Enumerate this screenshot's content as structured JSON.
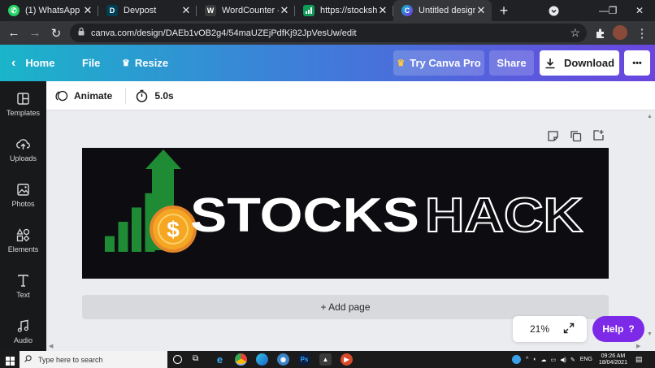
{
  "browser": {
    "tabs": [
      {
        "title": "(1) WhatsApp",
        "icon": "whatsapp-icon",
        "color": "#25d366"
      },
      {
        "title": "Devpost",
        "icon": "devpost-icon",
        "color": "#003e54"
      },
      {
        "title": "WordCounter - C",
        "icon": "wordcounter-icon",
        "color": "#3a3a3a"
      },
      {
        "title": "https://stocksha",
        "icon": "stocks-chart-icon",
        "color": "#0f9d58"
      },
      {
        "title": "Untitled design",
        "icon": "canva-icon",
        "color": "#00c4cc"
      }
    ],
    "new_tab_label": "+",
    "url": "canva.com/design/DAEb1vOB2g4/54maUZEjPdfKj92JpVesUw/edit"
  },
  "canva_header": {
    "home_label": "Home",
    "file_label": "File",
    "resize_label": "Resize",
    "try_pro_label": "Try Canva Pro",
    "share_label": "Share",
    "download_label": "Download",
    "more_label": "•••"
  },
  "sidebar": {
    "items": [
      {
        "label": "Templates",
        "icon": "templates-icon"
      },
      {
        "label": "Uploads",
        "icon": "upload-icon"
      },
      {
        "label": "Photos",
        "icon": "photos-icon"
      },
      {
        "label": "Elements",
        "icon": "elements-icon"
      },
      {
        "label": "Text",
        "icon": "text-icon"
      },
      {
        "label": "Audio",
        "icon": "audio-icon"
      }
    ]
  },
  "editor_toolbar": {
    "animate_label": "Animate",
    "duration": "5.0s"
  },
  "design": {
    "word_solid": "STOCKS",
    "word_outline": "HACK",
    "coin_symbol": "$",
    "bar_levels": [
      0.22,
      0.42,
      0.62,
      0.82,
      1.0
    ],
    "background": "#0d0d11",
    "bar_color": "#1f8b34",
    "coin_color": "#f5a623"
  },
  "canvas": {
    "add_page_label": "+ Add page",
    "zoom_level": "21%",
    "help_label": "Help",
    "help_icon": "?"
  },
  "taskbar": {
    "search_placeholder": "Type here to search",
    "language": "ENG",
    "time": "09:26 AM",
    "date": "18/04/2021"
  },
  "colors": {
    "canva_purple": "#7d2ae8",
    "header_start": "#1ab5c9",
    "header_end": "#6a45df"
  }
}
